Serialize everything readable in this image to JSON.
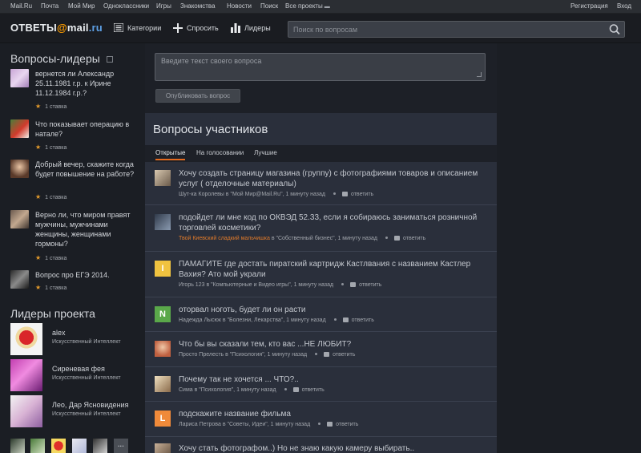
{
  "portal": {
    "left_links": [
      "Mail.Ru",
      "Почта",
      "Мой Мир",
      "Одноклассники",
      "Игры",
      "Знакомства",
      "Новости",
      "Поиск",
      "Все проекты"
    ],
    "right_links": [
      "Регистрация",
      "Вход"
    ]
  },
  "header": {
    "logo_main": "ОТВЕТЫ",
    "logo_at": "@",
    "logo_mail": "mail",
    "logo_ru": ".ru",
    "nav": [
      "Категории",
      "Спросить",
      "Лидеры"
    ],
    "search_placeholder": "Поиск по вопросам"
  },
  "left": {
    "top_questions_title": "Вопросы-лидеры",
    "top_questions": [
      {
        "text": "вернется ли Александр 25.11.1981 г.р. к Ирине 11.12.1984 г.р.?",
        "meta": "1 ставка"
      },
      {
        "text": "Что показывает операцию в натале?",
        "meta": "1 ставка"
      },
      {
        "text": "Добрый вечер, скажите когда будет повышение на работе?",
        "meta": "1 ставка"
      },
      {
        "text": "Верно ли, что миром правят мужчины, мужчинами женщины, женщинами гормоны?",
        "meta": "1 ставка"
      },
      {
        "text": "Вопрос про ЕГЭ 2014.",
        "meta": "1 ставка"
      }
    ],
    "leaders_title": "Лидеры проекта",
    "leaders": [
      {
        "name": "alex",
        "status": "Искусственный Интеллект"
      },
      {
        "name": "Сиреневая фея",
        "status": "Искусственный Интеллект"
      },
      {
        "name": "Лео, Дар Ясновидения",
        "status": "Искусственный Интеллект"
      }
    ],
    "more_label": "···"
  },
  "center": {
    "ask_placeholder": "Введите текст своего вопроса",
    "publish_label": "Опубликовать вопрос",
    "questions_title": "Вопросы участников",
    "tabs": [
      "Открытые",
      "На голосовании",
      "Лучшие"
    ],
    "answer_label": "ответить",
    "questions": [
      {
        "text": "Хочу создать страницу магазина (группу) с фотографиями товаров и описанием услуг ( отделочные материалы)",
        "author": "Шут-ка Короле­вы",
        "category": "в \"Мой Мир@Mail.Ru\"",
        "time": "1 минуту назад"
      },
      {
        "text": "подойдет ли мне код по ОКВЭД 52.33, если я собираюсь заниматься розничной торговлей косметики?",
        "author": "Твой Киевский сладкий мальчишка",
        "category": "в \"Собственный бизнес\"",
        "time": "1 минуту назад"
      },
      {
        "text": "ПАМАГИТЕ где достать пиратский картридж Кастлвания с названием Кастлер Вахия? Ато мой украли",
        "author": "Игорь 123",
        "category": "в \"Компьютерные и Видео игры\"",
        "time": "1 минуту назад",
        "letter": "I"
      },
      {
        "text": "оторвал ноготь, будет ли он расти",
        "author": "Надежда Лысюк",
        "category": "в \"Болезни, Лекарства\"",
        "time": "1 минуту назад",
        "letter": "N"
      },
      {
        "text": "Что бы вы сказали тем, кто вас ...НЕ ЛЮБИТ?",
        "author": "Просто Прелесть",
        "category": "в \"Психология\"",
        "time": "1 минуту назад"
      },
      {
        "text": "Почему так не хочется ... ЧТО?..",
        "author": "Сима",
        "category": "в \"Психология\"",
        "time": "1 минуту назад"
      },
      {
        "text": "подскажите название фильма",
        "author": "Лариса Петрова",
        "category": "в \"Советы, Идеи\"",
        "time": "1 минуту назад",
        "letter": "L"
      },
      {
        "text": "Хочу стать фотографом..) Но не знаю какую камеру выбирать..",
        "author": "",
        "category": "",
        "time": ""
      }
    ]
  },
  "colors": {
    "accent_orange": "#e46a1f",
    "logo_at": "#ff9e00",
    "logo_ru": "#5ea0e6",
    "author_highlight": "#e07a2a"
  }
}
